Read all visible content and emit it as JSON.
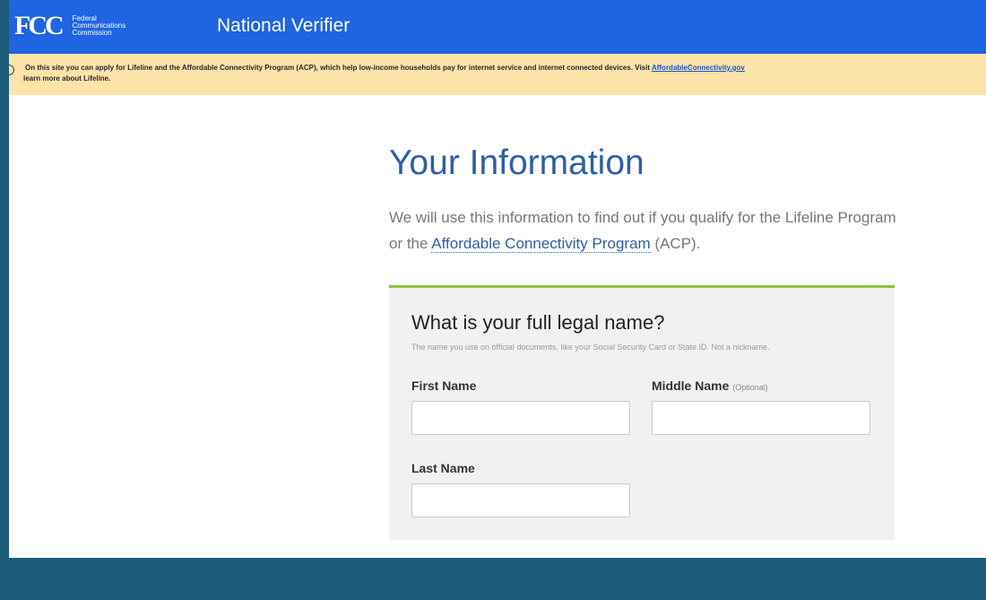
{
  "header": {
    "logo_mark": "FCC",
    "logo_lines": [
      "Federal",
      "Communications",
      "Commission"
    ],
    "app_title": "National Verifier"
  },
  "notice": {
    "text_before": "On this site you can apply for Lifeline and the Affordable Connectivity Program (ACP), which help low-income households pay for internet service and internet connected devices. Visit ",
    "link": "AffordableConnectivity.gov",
    "text_after": "learn more about Lifeline."
  },
  "main": {
    "title": "Your Information",
    "intro_before": "We will use this information to find out if you qualify for the Lifeline Program or the ",
    "intro_link": "Affordable Connectivity Program",
    "intro_after": " (ACP)."
  },
  "name_section": {
    "title": "What is your full legal name?",
    "help": "The name you use on official documents, like your Social Security Card or State ID. Not a nickname.",
    "first_name": {
      "label": "First Name",
      "value": ""
    },
    "middle_name": {
      "label": "Middle Name",
      "optional": "(Optional)",
      "value": ""
    },
    "last_name": {
      "label": "Last Name",
      "value": ""
    }
  },
  "colors": {
    "header_blue": "#1f64e0",
    "notice_bg": "#fbe3aa",
    "accent_green": "#8bc53f",
    "title_blue": "#2f5ea8",
    "outer_bg": "#1b5a78"
  }
}
